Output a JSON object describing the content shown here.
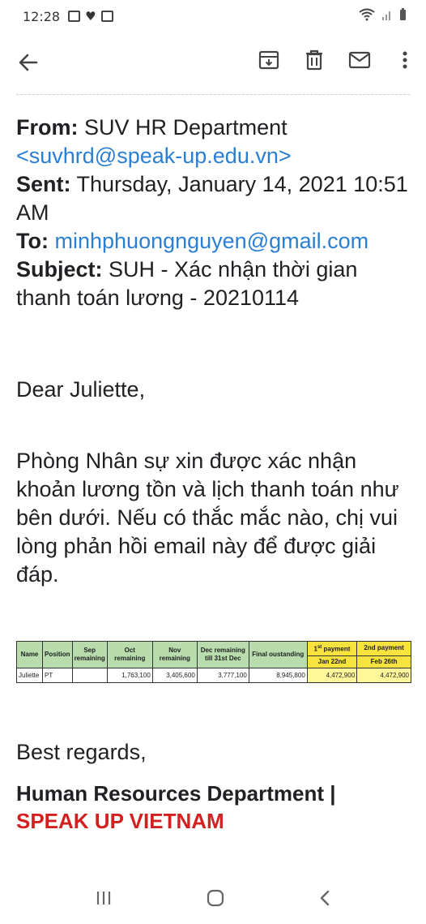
{
  "status": {
    "time": "12:28"
  },
  "email": {
    "from_label": "From:",
    "from_name": "SUV HR Department",
    "from_email": "<suvhrd@speak-up.edu.vn>",
    "sent_label": "Sent:",
    "sent_value": "Thursday, January 14, 2021 10:51 AM",
    "to_label": "To:",
    "to_value": "minhphuongnguyen@gmail.com",
    "subject_label": "Subject:",
    "subject_value": "SUH - Xác nhận thời gian thanh toán lương - 20210114",
    "greeting": "Dear Juliette,",
    "body": "Phòng Nhân sự xin được xác nhận khoản lương tồn và lịch thanh toán như bên dưới. Nếu có thắc mắc nào, chị vui lòng phản hồi email này để được giải đáp.",
    "regards": "Best regards,",
    "signature_line1": "Human Resources Department |",
    "signature_line2": "SPEAK UP VIETNAM"
  },
  "table": {
    "headers": {
      "name": "Name",
      "position": "Position",
      "sep": "Sep remaining",
      "oct": "Oct remaining",
      "nov": "Nov remaining",
      "dec": "Dec remaining till 31st Dec",
      "final": "Final oustanding",
      "p1_sup": "st",
      "p1": "1",
      "p1_rest": " payment",
      "p2": "2nd payment",
      "p1_date": "Jan 22nd",
      "p2_date": "Feb 26th"
    },
    "row": {
      "name": "Juliette",
      "position": "PT",
      "sep": "",
      "oct": "1,763,100",
      "nov": "3,405,600",
      "dec": "3,777,100",
      "final": "8,945,800",
      "p1": "4,472,900",
      "p2": "4,472,900"
    }
  },
  "colors": {
    "link": "#2a7fd4",
    "brand_red": "#d42020",
    "table_header_green": "#b8dcab",
    "table_payment_yellow": "#f7e23e"
  }
}
